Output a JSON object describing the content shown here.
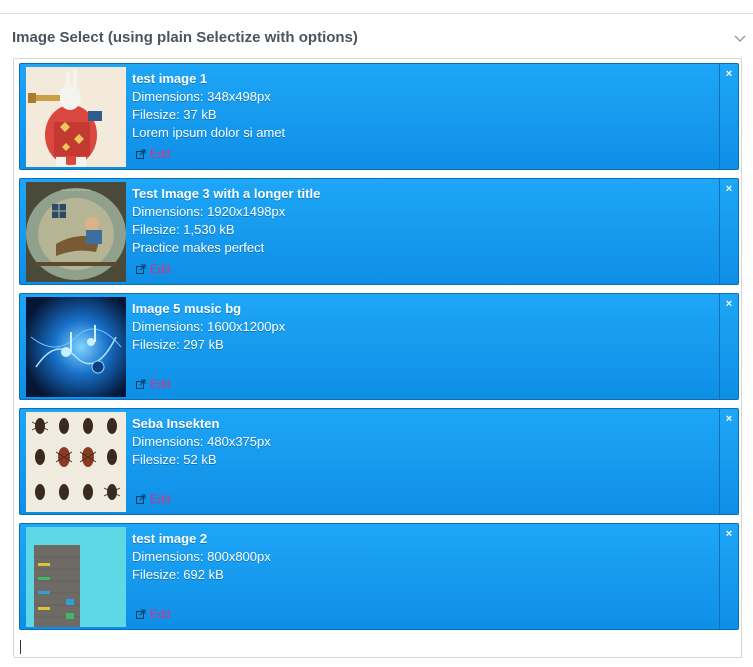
{
  "panel": {
    "title": "Image Select (using plain Selectize with options)",
    "toggle_icon": "chevron-down-icon"
  },
  "items": [
    {
      "title": "test image 1",
      "dimensions": "Dimensions: 348x498px",
      "filesize": "Filesize: 37 kB",
      "description": "Lorem ipsum dolor si amet",
      "edit_label": "Edit",
      "remove_label": "×"
    },
    {
      "title": "Test Image 3 with a longer title",
      "dimensions": "Dimensions: 1920x1498px",
      "filesize": "Filesize: 1,530 kB",
      "description": "Practice makes perfect",
      "edit_label": "Edit",
      "remove_label": "×"
    },
    {
      "title": "Image 5 music bg",
      "dimensions": "Dimensions: 1600x1200px",
      "filesize": "Filesize: 297 kB",
      "description": "",
      "edit_label": "Edit",
      "remove_label": "×"
    },
    {
      "title": "Seba Insekten",
      "dimensions": "Dimensions: 480x375px",
      "filesize": "Filesize: 52 kB",
      "description": "",
      "edit_label": "Edit",
      "remove_label": "×"
    },
    {
      "title": "test image 2",
      "dimensions": "Dimensions: 800x800px",
      "filesize": "Filesize: 692 kB",
      "description": "",
      "edit_label": "Edit",
      "remove_label": "×"
    }
  ],
  "colors": {
    "item_bg": "#1a9ff0",
    "item_border": "#0a6fb5",
    "edit_link": "#d6337b",
    "title_text": "#4a5560"
  }
}
